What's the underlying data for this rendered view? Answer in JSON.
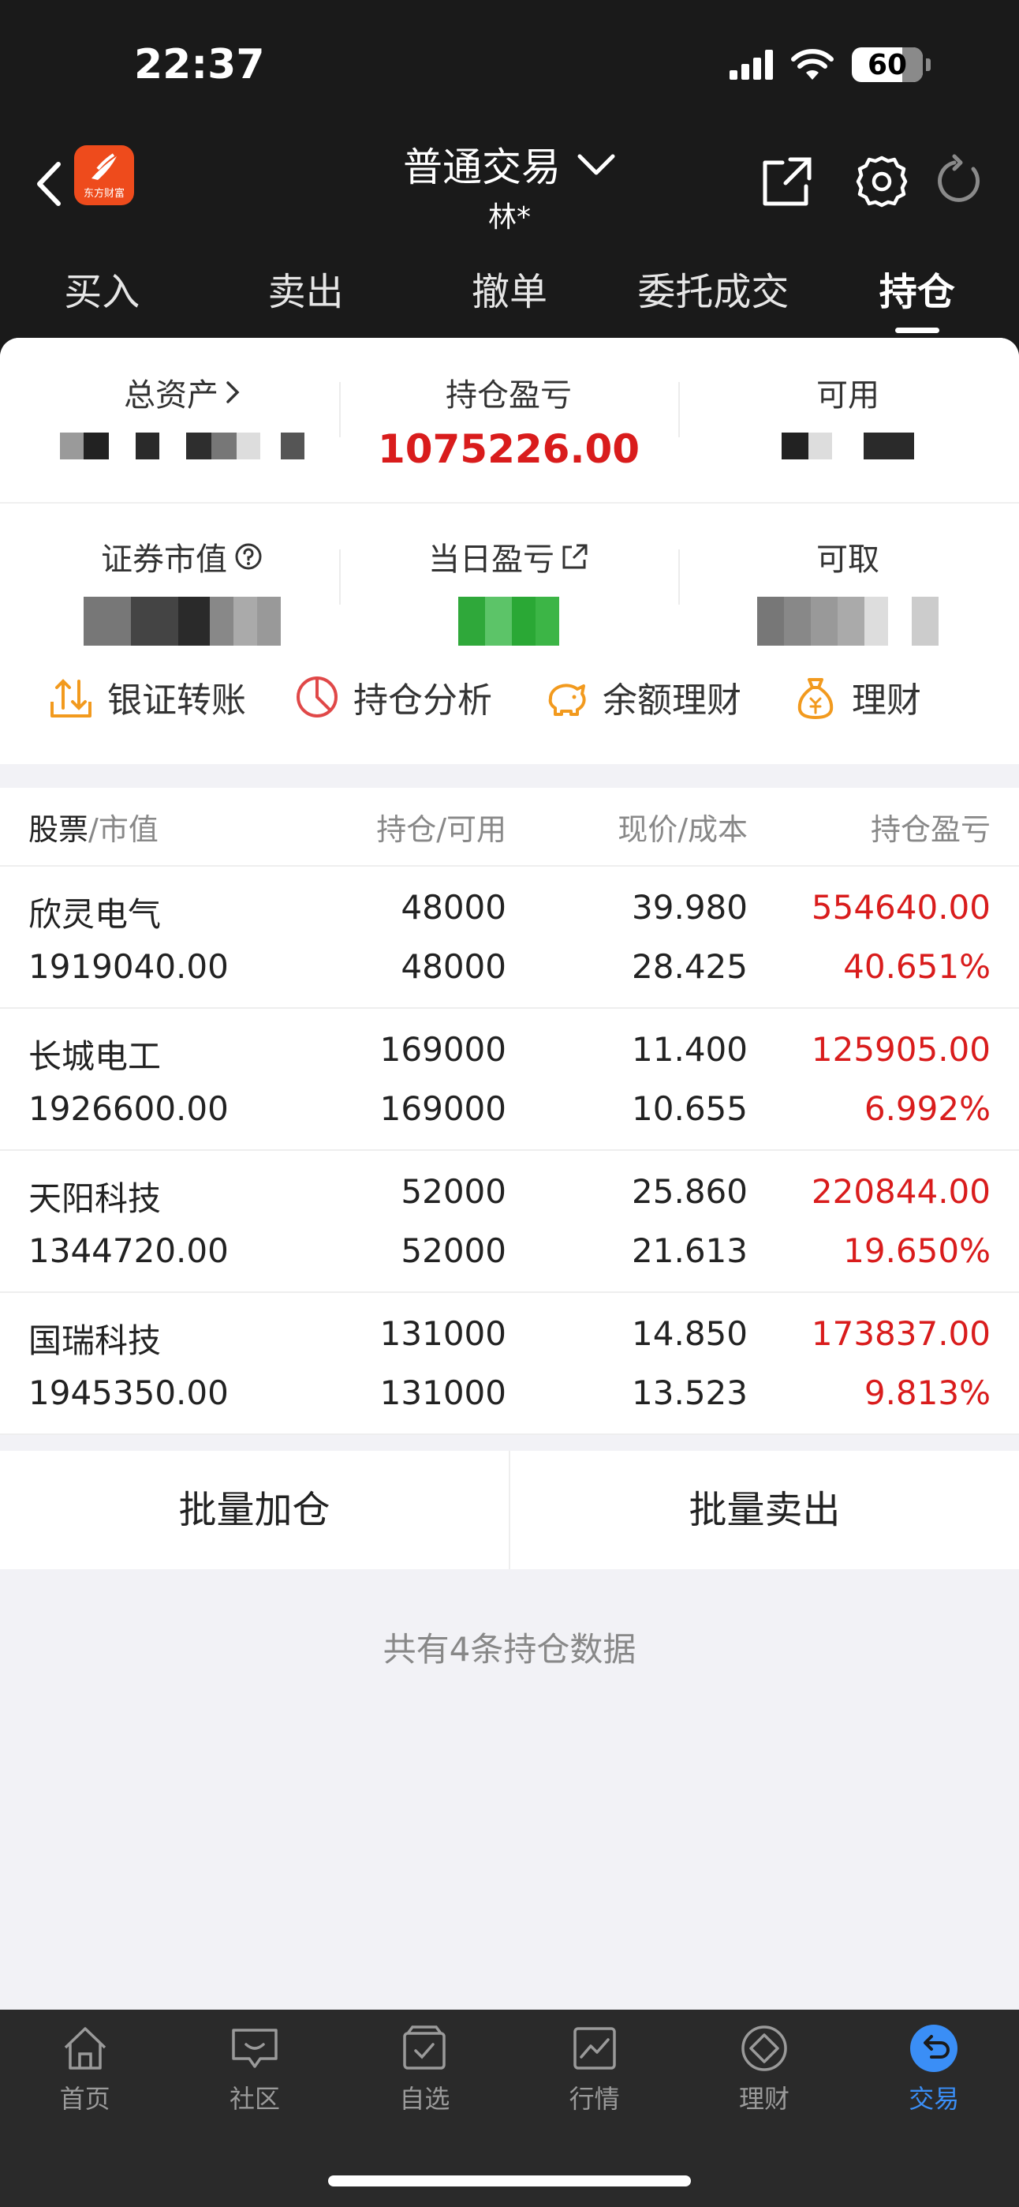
{
  "status_bar": {
    "time": "22:37",
    "battery": "60"
  },
  "header": {
    "title": "普通交易",
    "subtitle": "林*",
    "logo_text": "东方财富"
  },
  "tabs": [
    {
      "label": "买入"
    },
    {
      "label": "卖出"
    },
    {
      "label": "撤单"
    },
    {
      "label": "委托成交"
    },
    {
      "label": "持仓",
      "active": true
    }
  ],
  "summary": {
    "total_assets_label": "总资产",
    "position_pnl_label": "持仓盈亏",
    "position_pnl_value": "1075226.00",
    "available_label": "可用",
    "market_value_label": "证券市值",
    "daily_pnl_label": "当日盈亏",
    "withdrawable_label": "可取"
  },
  "quick_actions": [
    "银证转账",
    "持仓分析",
    "余额理财",
    "理财"
  ],
  "table": {
    "headers": {
      "stock": "股票",
      "market_value": "/市值",
      "position": "持仓/可用",
      "price": "现价/成本",
      "pnl": "持仓盈亏"
    },
    "rows": [
      {
        "name": "欣灵电气",
        "market_value": "1919040.00",
        "position": "48000",
        "available": "48000",
        "price": "39.980",
        "cost": "28.425",
        "pnl": "554640.00",
        "pnl_pct": "40.651%"
      },
      {
        "name": "长城电工",
        "market_value": "1926600.00",
        "position": "169000",
        "available": "169000",
        "price": "11.400",
        "cost": "10.655",
        "pnl": "125905.00",
        "pnl_pct": "6.992%"
      },
      {
        "name": "天阳科技",
        "market_value": "1344720.00",
        "position": "52000",
        "available": "52000",
        "price": "25.860",
        "cost": "21.613",
        "pnl": "220844.00",
        "pnl_pct": "19.650%"
      },
      {
        "name": "国瑞科技",
        "market_value": "1945350.00",
        "position": "131000",
        "available": "131000",
        "price": "14.850",
        "cost": "13.523",
        "pnl": "173837.00",
        "pnl_pct": "9.813%"
      }
    ]
  },
  "actions": {
    "batch_add": "批量加仓",
    "batch_sell": "批量卖出"
  },
  "footer_text": "共有4条持仓数据",
  "bottom_nav": [
    {
      "label": "首页",
      "icon": "home-icon"
    },
    {
      "label": "社区",
      "icon": "community-icon"
    },
    {
      "label": "自选",
      "icon": "watchlist-icon"
    },
    {
      "label": "行情",
      "icon": "market-icon"
    },
    {
      "label": "理财",
      "icon": "wealth-icon"
    },
    {
      "label": "交易",
      "icon": "trade-icon",
      "active": true
    }
  ],
  "colors": {
    "red": "#d91c1c",
    "accent_blue": "#3a8ef6",
    "brand_orange": "#ee4b1c"
  }
}
